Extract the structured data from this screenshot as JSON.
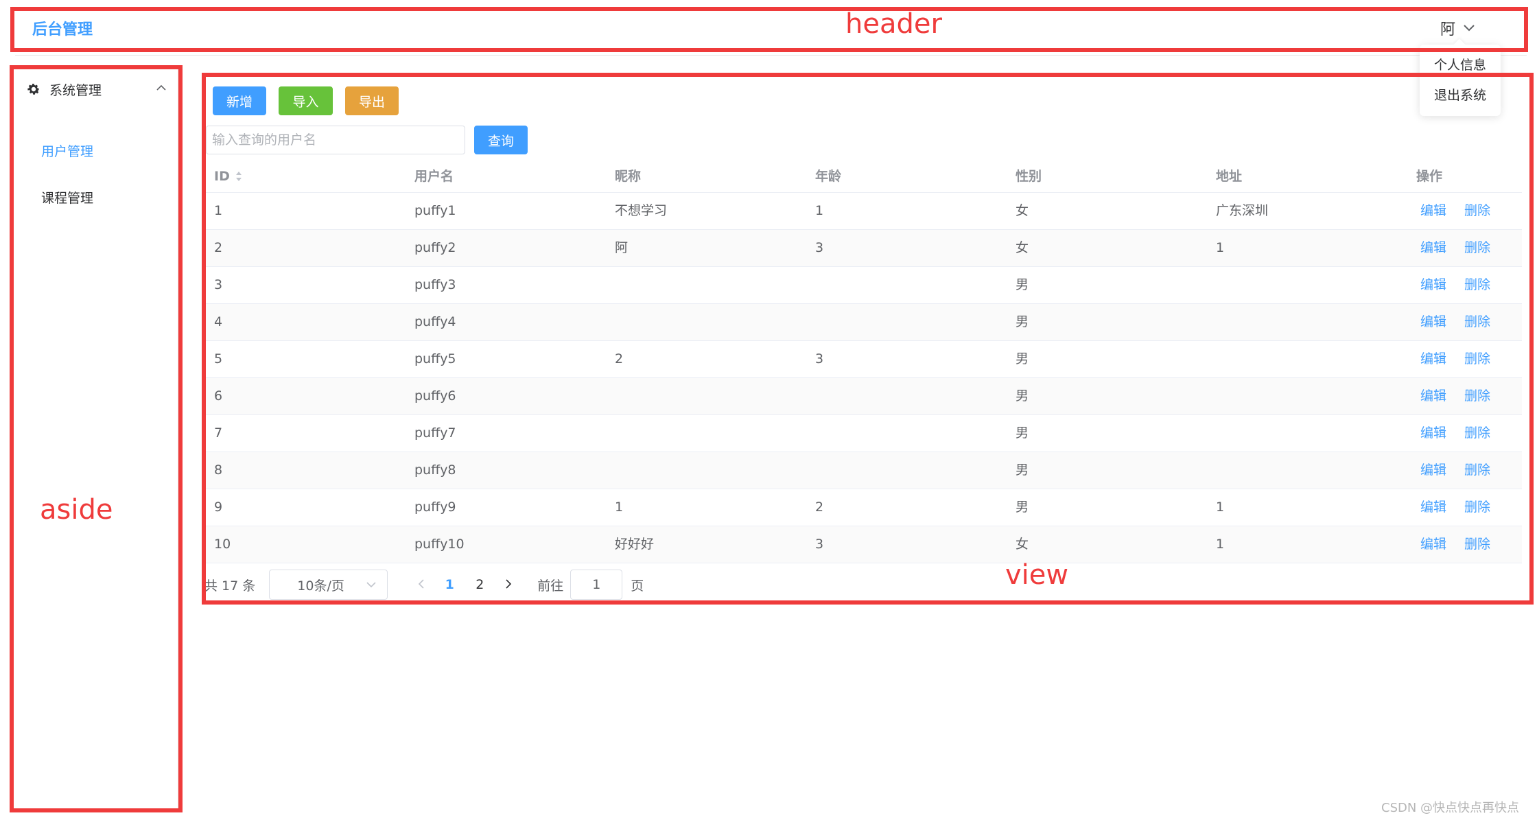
{
  "header": {
    "title": "后台管理",
    "user": {
      "name": "阿"
    },
    "dropdown": [
      "个人信息",
      "退出系统"
    ]
  },
  "aside": {
    "group": {
      "label": "系统管理",
      "icon": "gear-icon",
      "expand_icon": "chevron-up-icon"
    },
    "items": [
      {
        "label": "用户管理",
        "active": true
      },
      {
        "label": "课程管理",
        "active": false
      }
    ]
  },
  "toolbar": {
    "add_label": "新增",
    "import_label": "导入",
    "export_label": "导出",
    "search_placeholder": "输入查询的用户名",
    "search_label": "查询"
  },
  "table": {
    "columns": [
      "ID",
      "用户名",
      "昵称",
      "年龄",
      "性别",
      "地址",
      "操作"
    ],
    "edit_label": "编辑",
    "delete_label": "删除",
    "rows": [
      [
        "1",
        "puffy1",
        "不想学习",
        "1",
        "女",
        "广东深圳"
      ],
      [
        "2",
        "puffy2",
        "阿",
        "3",
        "女",
        "1"
      ],
      [
        "3",
        "puffy3",
        "",
        "",
        "男",
        ""
      ],
      [
        "4",
        "puffy4",
        "",
        "",
        "男",
        ""
      ],
      [
        "5",
        "puffy5",
        "2",
        "3",
        "男",
        ""
      ],
      [
        "6",
        "puffy6",
        "",
        "",
        "男",
        ""
      ],
      [
        "7",
        "puffy7",
        "",
        "",
        "男",
        ""
      ],
      [
        "8",
        "puffy8",
        "",
        "",
        "男",
        ""
      ],
      [
        "9",
        "puffy9",
        "1",
        "2",
        "男",
        "1"
      ],
      [
        "10",
        "puffy10",
        "好好好",
        "3",
        "女",
        "1"
      ]
    ]
  },
  "pagination": {
    "total": "共 17 条",
    "page_size": "10条/页",
    "pages": [
      "1",
      "2"
    ],
    "current": "1",
    "goto_label": "前往",
    "jump_value": "1",
    "page_suffix": "页"
  },
  "annotations": {
    "header": "header",
    "aside": "aside",
    "view": "view"
  },
  "watermark": "CSDN @快点快点再快点",
  "colors": {
    "primary": "#409eff",
    "success": "#67c23a",
    "warning": "#e6a23c",
    "annotation": "#ef3b3b"
  }
}
